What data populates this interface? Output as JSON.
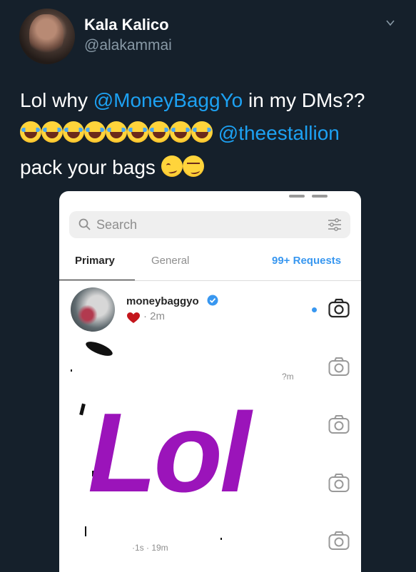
{
  "tweet": {
    "display_name": "Kala Kalico",
    "handle": "@alakammai",
    "text_prefix": "Lol why ",
    "mention1": "@MoneyBaggYo",
    "text_mid": " in my DMs??",
    "mention2": "@theestallion",
    "line3": "pack your bags"
  },
  "dm_screen": {
    "search_placeholder": "Search",
    "tabs": {
      "primary": "Primary",
      "general": "General",
      "requests": "99+ Requests"
    },
    "thread": {
      "username": "moneybaggyo",
      "time": "· 2m"
    },
    "faded_time_1": "?m",
    "faded_time_2": "·1s · 19m"
  },
  "overlay_text": "Lol",
  "icons": [
    "avatar",
    "chevron-down-icon",
    "laughing-emoji-icon",
    "woozy-emoji-icon",
    "smirk-emoji-icon",
    "search-icon",
    "filter-icon",
    "verified-icon",
    "heart-icon",
    "camera-icon"
  ],
  "colors": {
    "background": "#15202b",
    "mention": "#1da1f2",
    "overlay": "#9b14ba",
    "ig_blue": "#3897f0"
  }
}
